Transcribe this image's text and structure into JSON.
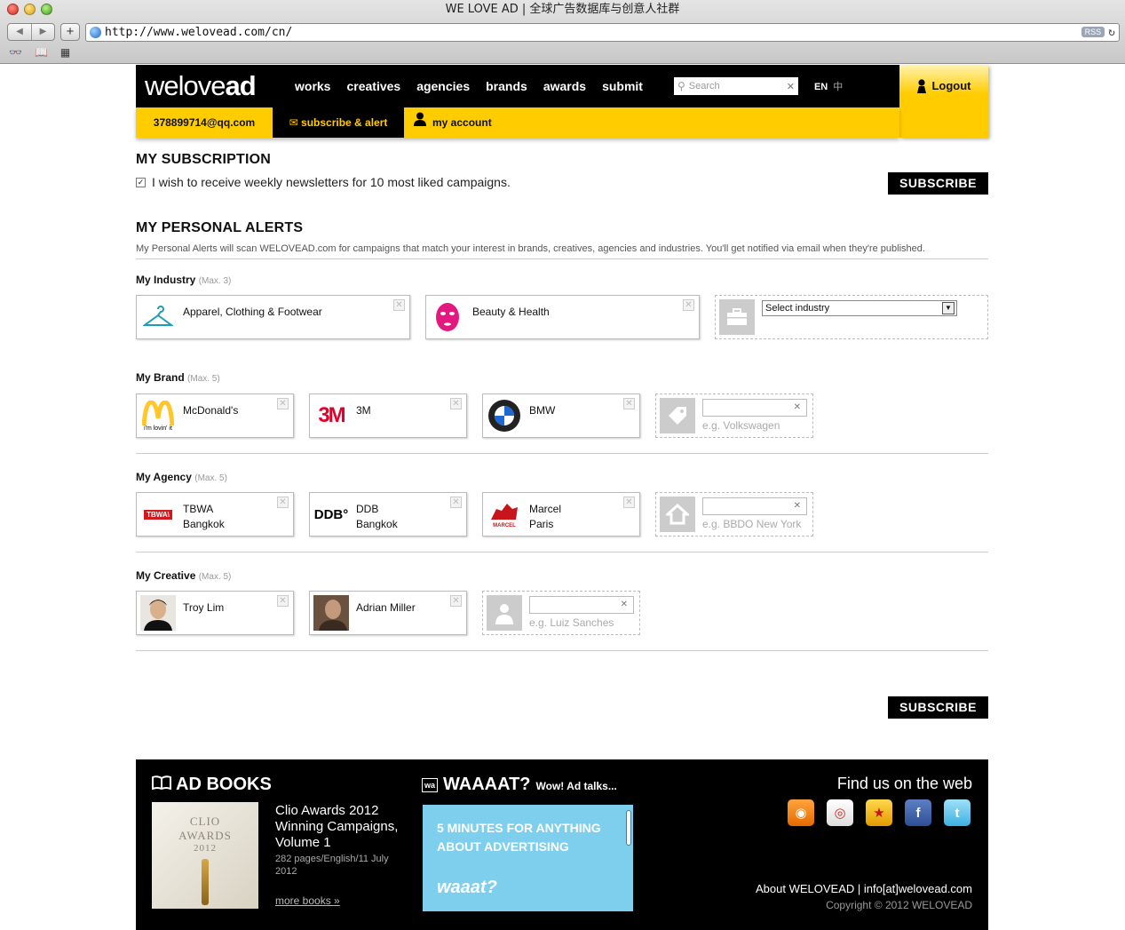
{
  "window": {
    "title": "WE LOVE AD | 全球广告数据库与创意人社群",
    "url": "http://www.welovead.com/cn/",
    "rss_label": "RSS"
  },
  "header": {
    "logo_light": "welove",
    "logo_bold": "ad",
    "nav": [
      "works",
      "creatives",
      "agencies",
      "brands",
      "awards",
      "submit"
    ],
    "search_placeholder": "Search",
    "lang_en": "EN",
    "lang_zh": "中",
    "logout_label": "Logout",
    "user_email": "378899714@qq.com",
    "subscribe_alert_label": "subscribe & alert",
    "my_account_label": "my account"
  },
  "subscription": {
    "title": "MY SUBSCRIPTION",
    "checkbox_label": "I wish to receive weekly newsletters for 10 most liked campaigns.",
    "checked": true,
    "subscribe_label": "SUBSCRIBE"
  },
  "alerts": {
    "title": "MY PERSONAL ALERTS",
    "description": "My Personal Alerts will scan WELOVEAD.com for campaigns that match your interest in brands, creatives, agencies and industries. You'll get notified via email when they're published.",
    "industry": {
      "label": "My Industry",
      "max": "(Max. 3)",
      "items": [
        "Apparel, Clothing & Footwear",
        "Beauty & Health"
      ],
      "select_label": "Select industry"
    },
    "brand": {
      "label": "My Brand",
      "max": "(Max. 5)",
      "items": [
        "McDonald's",
        "3M",
        "BMW"
      ],
      "hint": "e.g. Volkswagen",
      "logo_text": [
        "i'm lovin' it",
        "3M"
      ]
    },
    "agency": {
      "label": "My Agency",
      "max": "(Max. 5)",
      "items": [
        {
          "name": "TBWA",
          "city": "Bangkok",
          "logo": "TBWA\\"
        },
        {
          "name": "DDB",
          "city": "Bangkok",
          "logo": "DDB°"
        },
        {
          "name": "Marcel",
          "city": "Paris",
          "logo": "MARCEL"
        }
      ],
      "hint": "e.g. BBDO New York"
    },
    "creative": {
      "label": "My Creative",
      "max": "(Max. 5)",
      "items": [
        "Troy Lim",
        "Adrian Miller"
      ],
      "hint": "e.g. Luiz Sanches"
    }
  },
  "footer": {
    "books_title": "AD BOOKS",
    "book_cover": [
      "CLIO",
      "AWARDS",
      "2012"
    ],
    "book_title": "Clio Awards 2012 Winning Campaigns, Volume 1",
    "book_meta": "282 pages/English/11 July 2012",
    "more_books": "more books »",
    "waaat_title": "WAAAAT?",
    "waaat_sub": "Wow! Ad talks...",
    "waaat_icon": "wa",
    "waaat_banner_line": "5 MINUTES FOR ANYTHING ABOUT ADVERTISING",
    "waaat_brand": "waaat?",
    "find_us": "Find us on the web",
    "links": "About WELOVEAD | info[at]welovead.com",
    "copyright": "Copyright © 2012 WELOVEAD"
  },
  "colors": {
    "accent_yellow": "#ffcc00",
    "black": "#000000"
  }
}
